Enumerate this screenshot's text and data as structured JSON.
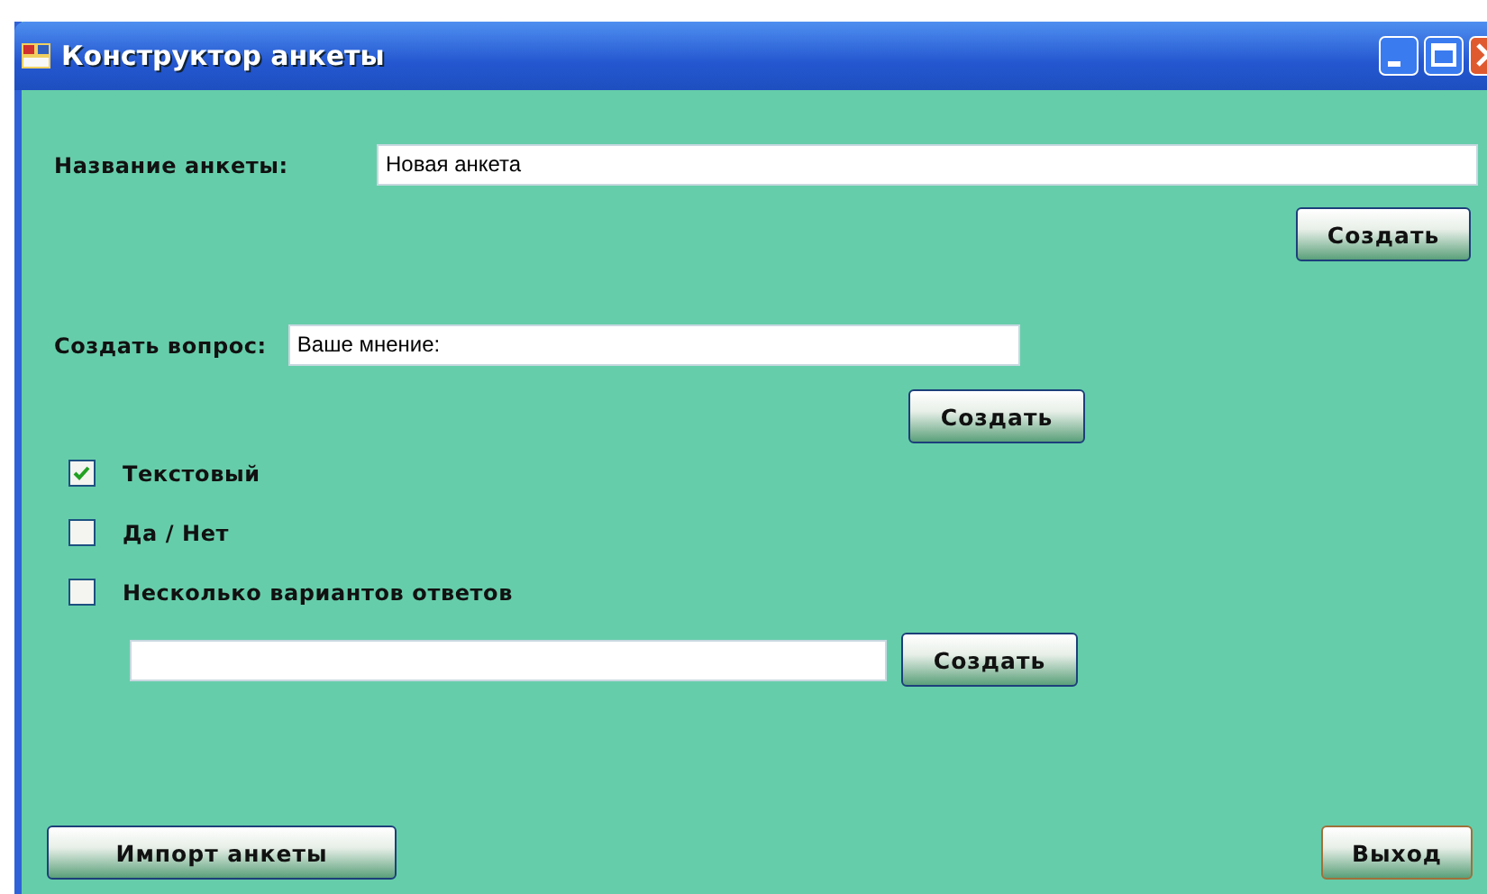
{
  "window": {
    "title": "Конструктор анкеты"
  },
  "survey_name": {
    "label": "Название анкеты:",
    "value": "Новая анкета",
    "button": "Создать"
  },
  "question": {
    "label": "Создать вопрос:",
    "value": "Ваше мнение:",
    "button": "Создать"
  },
  "answer_types": [
    {
      "label": "Текстовый",
      "checked": true
    },
    {
      "label": "Да / Нет",
      "checked": false
    },
    {
      "label": "Несколько вариантов ответов",
      "checked": false
    }
  ],
  "option": {
    "button": "Создать"
  },
  "footer": {
    "import_button": "Импорт анкеты",
    "exit_button": "Выход"
  }
}
